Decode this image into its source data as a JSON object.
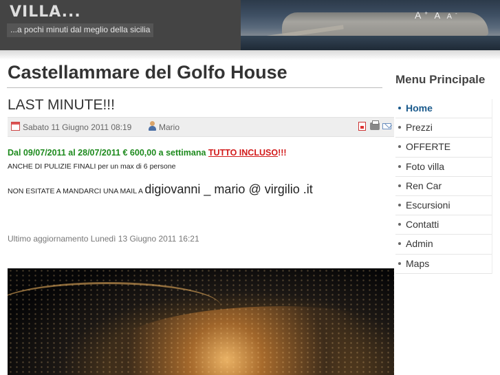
{
  "header": {
    "site_title": "VILLA...",
    "tagline": "...a pochi minuti dal meglio della sicilia",
    "font_controls": {
      "increase": "A",
      "reset": "A",
      "decrease": "A",
      "increase_sup": "+",
      "decrease_sup": "-"
    }
  },
  "main": {
    "page_title": "Castellammare del Golfo House",
    "article": {
      "title": "LAST MINUTE!!!",
      "date": "Sabato 11 Giugno 2011 08:19",
      "author": "Mario",
      "offer_text": "Dal 09/07/2011 al 28/07/2011 € 600,00 a settimana ",
      "offer_included": "TUTTO INCLUSO",
      "offer_exclaim": "!!!",
      "cleaning_text": "ANCHE DI PULIZIE FINALI per un max di 6 persone",
      "contact_prefix": "NON ESITATE A MANDARCI UNA MAIL A ",
      "contact_email": "digiovanni _ mario @ virgilio .it",
      "last_updated": "Ultimo aggiornamento Lunedì 13 Giugno 2011 16:21"
    }
  },
  "sidebar": {
    "menu_title": "Menu Principale",
    "items": [
      {
        "label": "Home"
      },
      {
        "label": "Prezzi"
      },
      {
        "label": "OFFERTE"
      },
      {
        "label": "Foto villa"
      },
      {
        "label": "Ren Car"
      },
      {
        "label": "Escursioni"
      },
      {
        "label": "Contatti"
      },
      {
        "label": "Admin"
      },
      {
        "label": "Maps"
      }
    ]
  },
  "colors": {
    "header_bg": "#444444",
    "active_menu": "#1a5a8c",
    "offer_green": "#1d8a1d",
    "offer_red": "#d21b1b"
  },
  "icons": [
    "calendar-icon",
    "user-icon",
    "pdf-icon",
    "print-icon",
    "email-icon"
  ]
}
